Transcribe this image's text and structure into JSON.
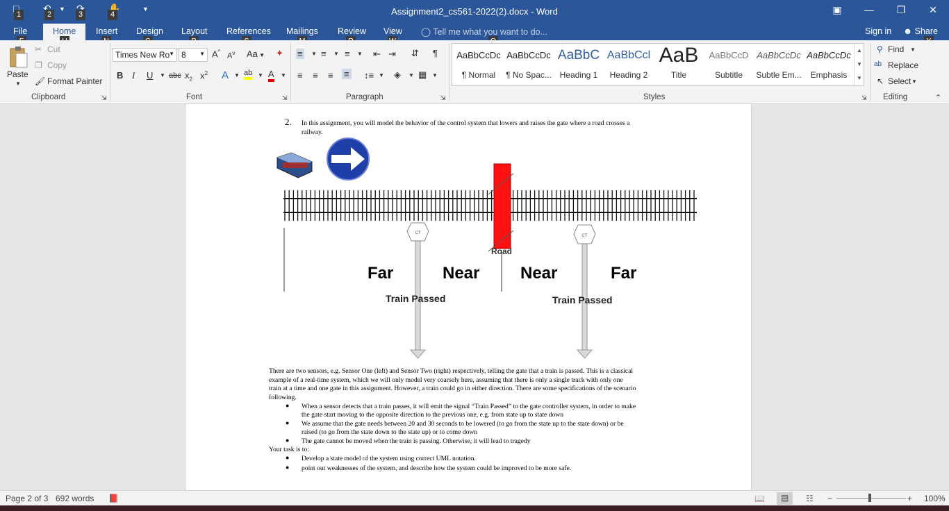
{
  "titlebar": {
    "title": "Assignment2_cs561-2022(2).docx - Word",
    "qat_keytips": [
      "1",
      "2",
      "3",
      "4"
    ],
    "restore_icon": "ribbon-display-icon",
    "minimize": "—",
    "maximize": "❐",
    "close": "✕"
  },
  "tabs": [
    {
      "label": "File",
      "key": "F"
    },
    {
      "label": "Home",
      "key": "H"
    },
    {
      "label": "Insert",
      "key": "N"
    },
    {
      "label": "Design",
      "key": "G"
    },
    {
      "label": "Layout",
      "key": "P"
    },
    {
      "label": "References",
      "key": "S"
    },
    {
      "label": "Mailings",
      "key": "M"
    },
    {
      "label": "Review",
      "key": "R"
    },
    {
      "label": "View",
      "key": "W"
    }
  ],
  "tellme": {
    "placeholder": "Tell me what you want to do...",
    "key": "Q"
  },
  "signin": "Sign in",
  "share": {
    "label": "Share",
    "key": "Y"
  },
  "clipboard": {
    "paste": "Paste",
    "cut": "Cut",
    "copy": "Copy",
    "format_painter": "Format Painter",
    "group": "Clipboard"
  },
  "font": {
    "name": "Times New Ro",
    "size": "8",
    "group": "Font",
    "case": "Aa"
  },
  "paragraph": {
    "group": "Paragraph"
  },
  "styles": {
    "group": "Styles",
    "items": [
      {
        "preview": "AaBbCcDc",
        "name": "¶ Normal"
      },
      {
        "preview": "AaBbCcDc",
        "name": "¶ No Spac..."
      },
      {
        "preview": "AaBbC",
        "name": "Heading 1"
      },
      {
        "preview": "AaBbCcl",
        "name": "Heading 2"
      },
      {
        "preview": "AaB",
        "name": "Title"
      },
      {
        "preview": "AaBbCcD",
        "name": "Subtitle"
      },
      {
        "preview": "AaBbCcDc",
        "name": "Subtle Em..."
      },
      {
        "preview": "AaBbCcDc",
        "name": "Emphasis"
      }
    ]
  },
  "editing": {
    "find": "Find",
    "replace": "Replace",
    "select": "Select",
    "group": "Editing"
  },
  "document": {
    "item_number": "2.",
    "intro_line1": "In this assignment, you will model the behavior of the control system that lowers and raises the gate where a road crosses a",
    "intro_line2": "railway.",
    "diagram": {
      "road": "Road",
      "far_left": "Far",
      "near_left": "Near",
      "near_right": "Near",
      "far_right": "Far",
      "passed_left": "Train Passed",
      "passed_right": "Train Passed",
      "sensor_label": "CT"
    },
    "para_lines": [
      "There are two sensors, e.g. Sensor One (left) and Sensor Two (right) respectively, telling the gate that a train is passed. This is a classical",
      "example of a real-time system, which we will only model very coarsely here, assuming that there is only a single track with only one",
      "train at a time and one gate in this assignment. However, a train could go in either direction. There are some specifications of the scenario",
      "following."
    ],
    "bullets": [
      [
        "When a sensor detects that a train passes, it will emit the signal “Train Passed” to the gate controller system, in order to make",
        "the gate start moving to the opposite direction to the previous one, e.g. from state up to state down"
      ],
      [
        "We assume that the gate needs between 20 and 30 seconds to be lowered (to go from the state up to the state down) or be",
        "raised (to go from the state down to the state up) or to come down"
      ],
      [
        "The gate cannot be moved when the train is passing. Otherwise, it will lead to tragedy"
      ]
    ],
    "task_heading": "Your task is to:",
    "tasks": [
      "Develop a state model of the system using correct UML notation.",
      "point out weaknesses of the system, and describe how the system could be improved to be more safe."
    ]
  },
  "status": {
    "page": "Page 2 of 3",
    "words": "692 words",
    "zoom": "100%"
  }
}
